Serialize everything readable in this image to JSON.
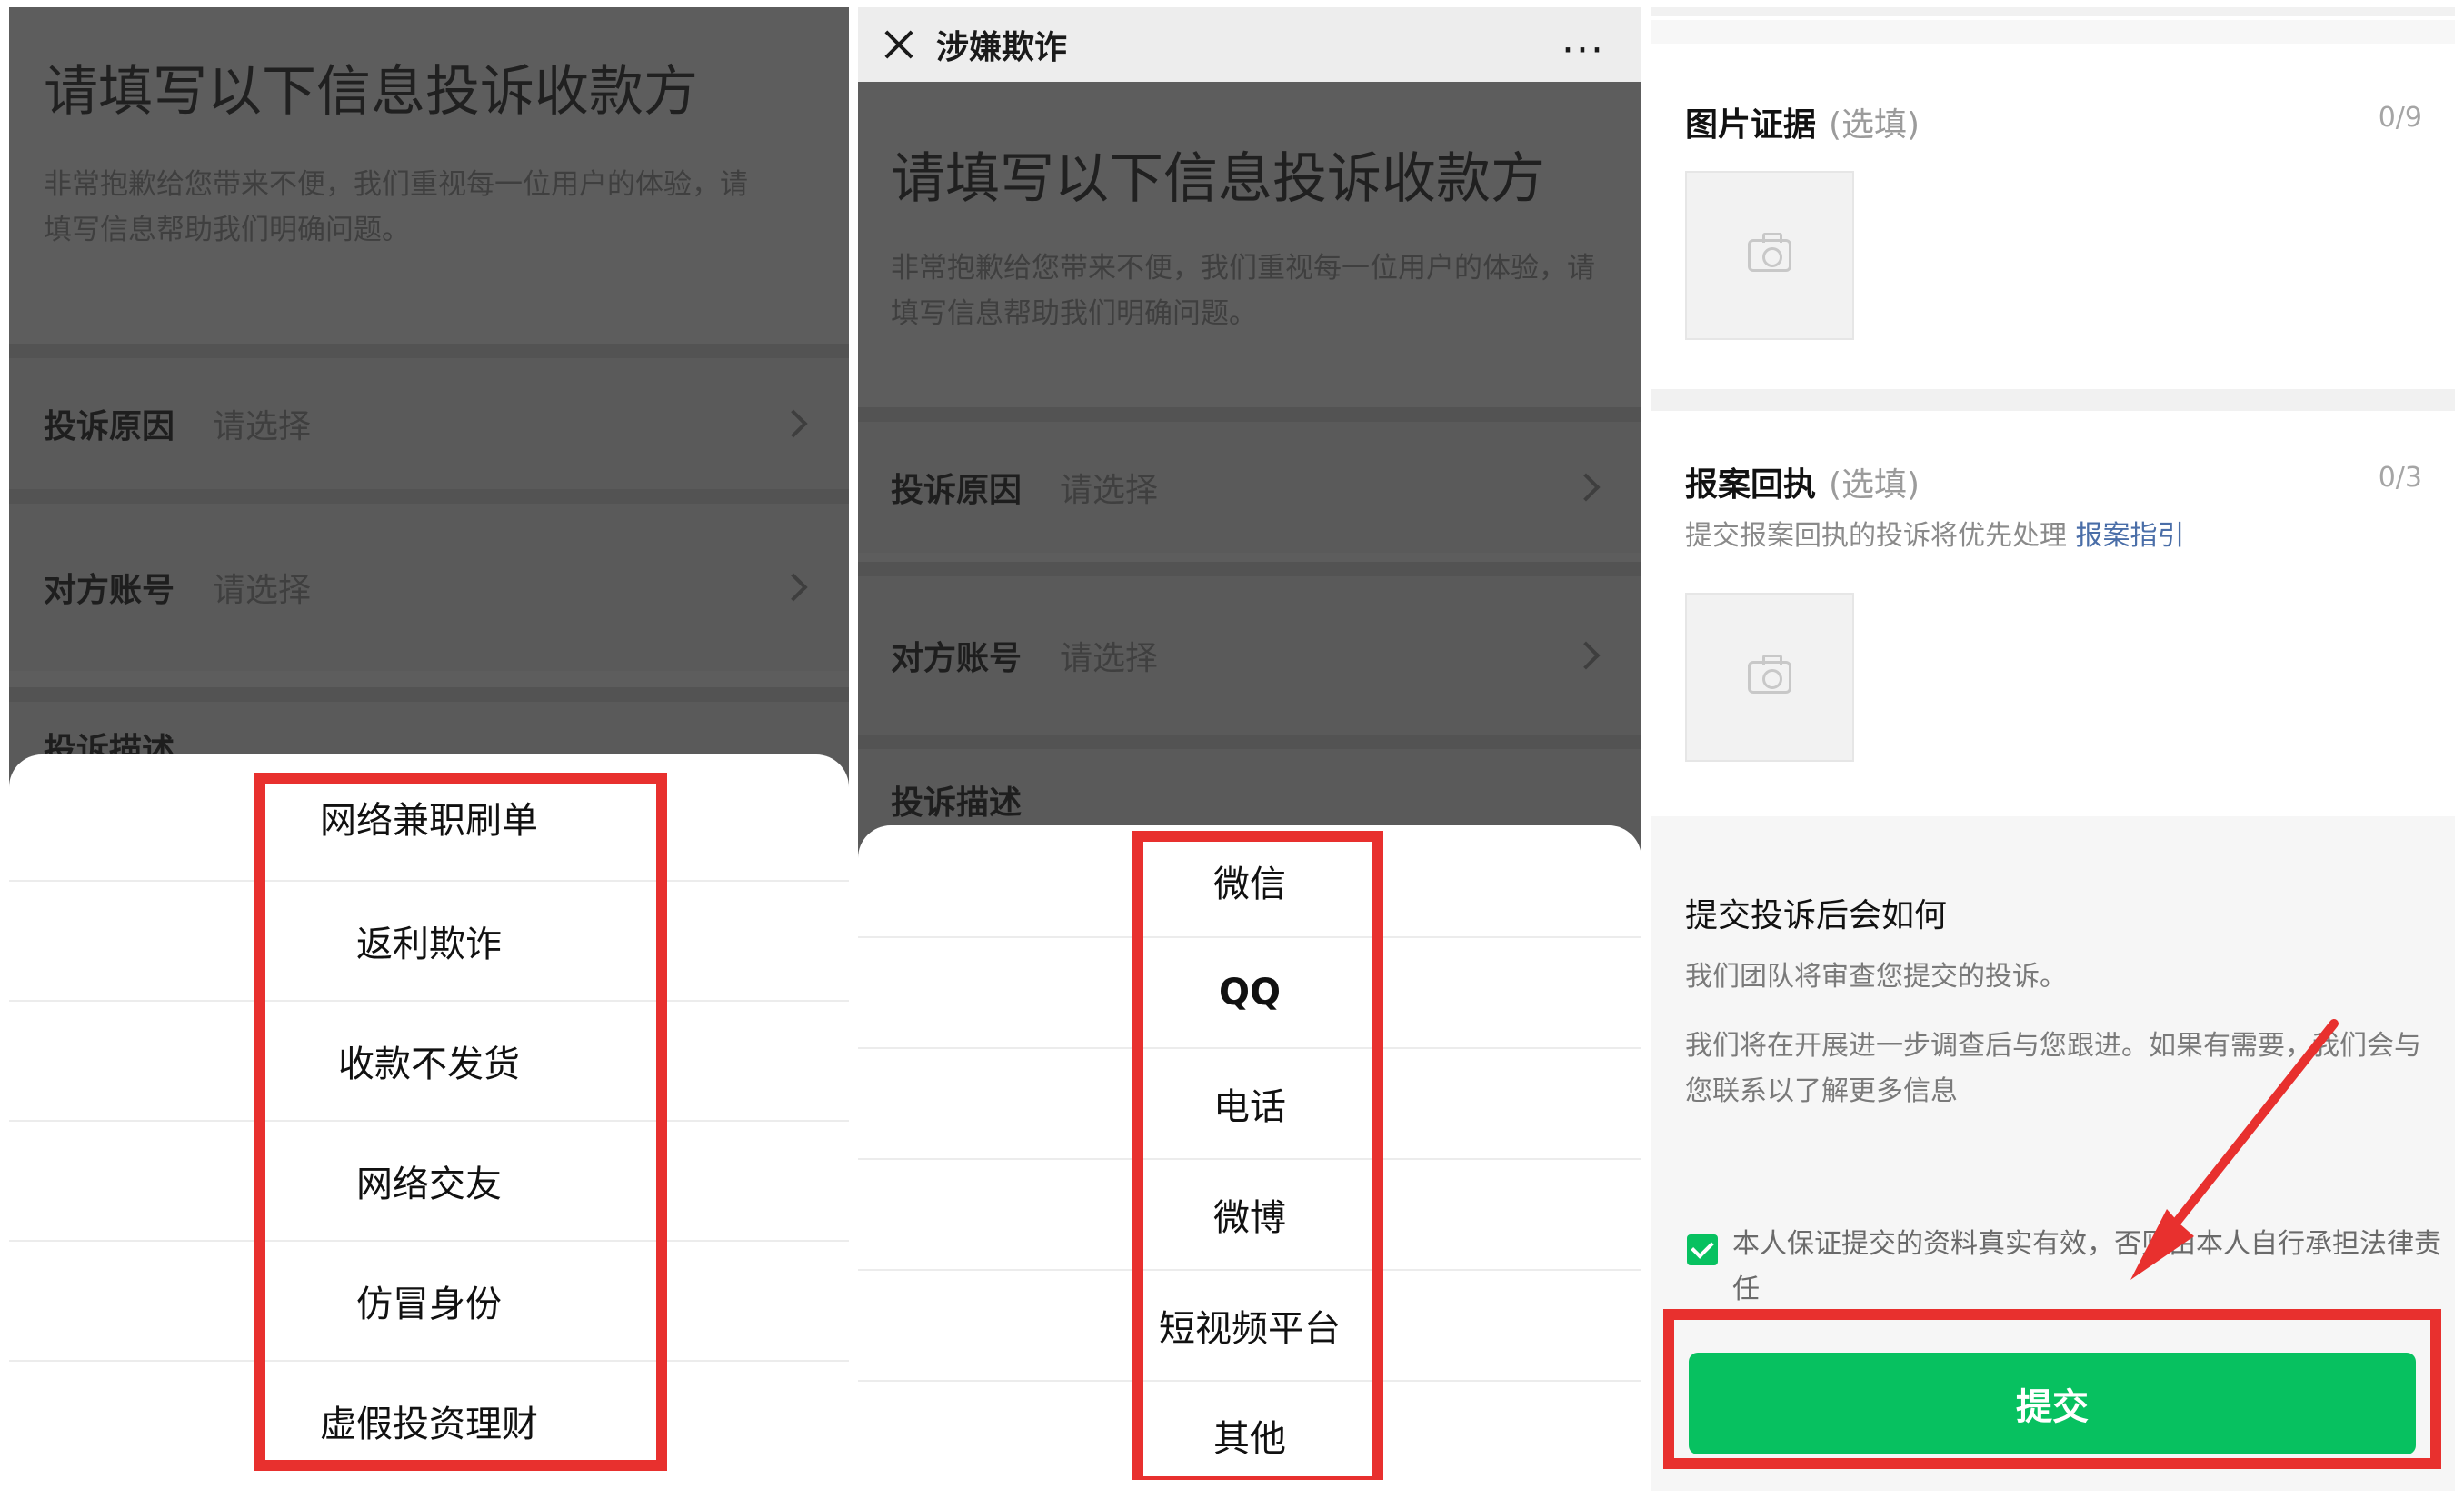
{
  "colors": {
    "accent_green": "#07c160",
    "highlight_red": "#e8302e",
    "link_blue": "#4a6ea8"
  },
  "panel1": {
    "title": "请填写以下信息投诉收款方",
    "desc_line1": "非常抱歉给您带来不便，我们重视每一位用户的体验，请",
    "desc_line2": "填写信息帮助我们明确问题。",
    "reason_label": "投诉原因",
    "reason_value": "请选择",
    "account_label": "对方账号",
    "account_value": "请选择",
    "desc_label": "投诉描述",
    "sheet_items": [
      "网络兼职刷单",
      "返利欺诈",
      "收款不发货",
      "网络交友",
      "仿冒身份",
      "虚假投资理财"
    ]
  },
  "panel2": {
    "nav_title": "涉嫌欺诈",
    "more": "···",
    "title": "请填写以下信息投诉收款方",
    "desc_line1": "非常抱歉给您带来不便，我们重视每一位用户的体验，请",
    "desc_line2": "填写信息帮助我们明确问题。",
    "reason_label": "投诉原因",
    "reason_value": "请选择",
    "account_label": "对方账号",
    "account_value": "请选择",
    "desc_label": "投诉描述",
    "sheet_items": [
      "微信",
      "QQ",
      "电话",
      "微博",
      "短视频平台",
      "其他"
    ]
  },
  "panel3": {
    "photo_title": "图片证据",
    "photo_optional": "(选填)",
    "photo_count": "0/9",
    "receipt_title": "报案回执",
    "receipt_optional": "(选填)",
    "receipt_count": "0/3",
    "receipt_hint": "提交报案回执的投诉将优先处理",
    "receipt_link": "报案指引",
    "info_title": "提交投诉后会如何",
    "info_text1": "我们团队将审查您提交的投诉。",
    "info_text2": "我们将在开展进一步调查后与您跟进。如果有需要，我们会与您联系以了解更多信息",
    "agree_text": "本人保证提交的资料真实有效，否则由本人自行承担法律责任",
    "submit_label": "提交"
  }
}
